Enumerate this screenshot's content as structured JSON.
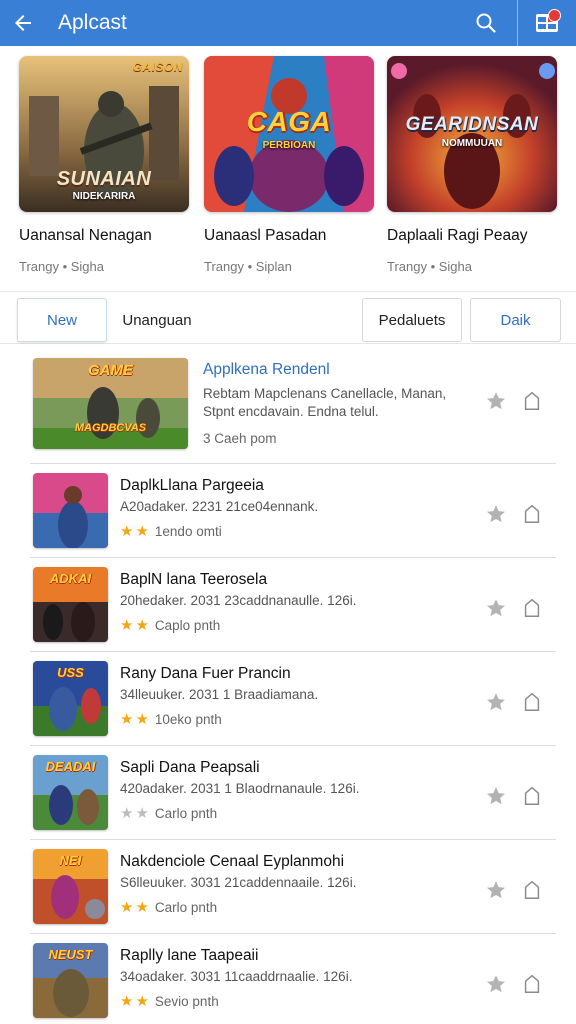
{
  "appbar": {
    "title": "Aplcast",
    "back_icon": "arrow-left-icon",
    "search_icon": "search-icon",
    "menu_icon": "apps-grid-icon"
  },
  "featured": [
    {
      "title": "Uanansal Nenagan",
      "subtitle": "Trangy • Sigha",
      "logo_text": "SUNAIAN",
      "logo_sub": "NIDEKARIRA",
      "top_logo": "GAISON"
    },
    {
      "title": "Uanaasl Pasadan",
      "subtitle": "Trangy • Siplan",
      "logo_text": "CAGA",
      "logo_sub": "PERBIOAN"
    },
    {
      "title": "Daplaali Ragi Peaay",
      "subtitle": "Trangy • Sigha",
      "logo_text": "GEARIDNSAN",
      "logo_sub": "NOMMUUAN"
    }
  ],
  "tabs": {
    "new": "New",
    "unanguan": "Unanguan",
    "pedaluets": "Pedaluets",
    "daik": "Daik"
  },
  "list": [
    {
      "title": "Applkena Rendenl",
      "desc1": "Rebtam Mapclenans Canellacle, Manan,",
      "desc2": "Stpnt encdavain. Endna telul.",
      "meta": "3 Caeh pom",
      "stars": 0,
      "logo": "GAME",
      "logo2": "MAGDBCVAS"
    },
    {
      "title": "DaplkLlana Pargeeia",
      "desc1": "A20adaker. 2231 21ce04ennank.",
      "meta": "1endo omti",
      "stars": 2,
      "logo": ""
    },
    {
      "title": "BaplN lana Teerosela",
      "desc1": "20hedaker. 2031 23caddnanaulle. 126i.",
      "meta": "Caplo pnth",
      "stars": 2,
      "logo": "ADKAI"
    },
    {
      "title": "Rany Dana Fuer Prancin",
      "desc1": "34lleuuker. 2031 1 Braadiamana.",
      "meta": "10eko pnth",
      "stars": 2,
      "logo": "USS"
    },
    {
      "title": "Sapli Dana Peapsali",
      "desc1": "420adaker. 2031 1 Blaodrnanaule. 126i.",
      "meta": "Carlo pnth",
      "stars": 0,
      "logo": "DEADAI"
    },
    {
      "title": "Nakdenciole Cenaal Eyplanmohi",
      "desc1": "S6lleuuker. 3031 21caddennaaile. 126i.",
      "meta": "Carlo pnth",
      "stars": 2,
      "logo": "NEI"
    },
    {
      "title": "Raplly lane Taapeaii",
      "desc1": "34oadaker. 3031 11caaddrnaalie. 126i.",
      "meta": "Sevio pnth",
      "stars": 2,
      "logo": "NEUST"
    }
  ],
  "row_icons": {
    "star": "star-icon",
    "bookmark": "bookmark-icon"
  },
  "colors": {
    "appbar": "#3a7fd6",
    "accent": "#2f6fc2",
    "star": "#f2a814"
  }
}
